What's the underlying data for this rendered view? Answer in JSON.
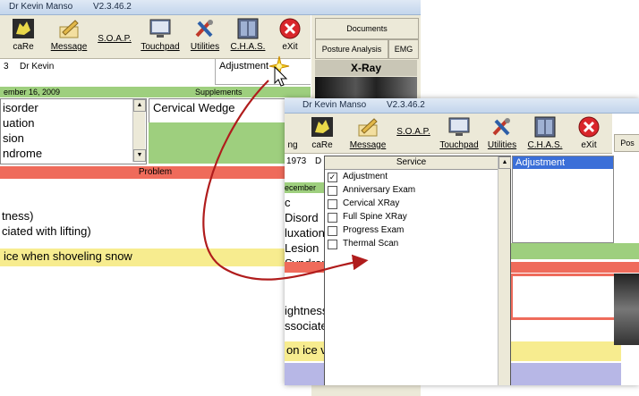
{
  "back": {
    "title": "Dr Kevin Manso",
    "version": "V2.3.46.2",
    "toolbar": [
      "caRe",
      "Message",
      "S.O.A.P.",
      "Touchpad",
      "Utilities",
      "C.H.A.S.",
      "eXit"
    ],
    "patient_num": "3",
    "patient_doc": "Dr Kevin",
    "adjustment_label": "Adjustment",
    "date_bar": "ember 16, 2009",
    "supplements_label": "Supplements",
    "diagnoses": [
      "isorder",
      "uation",
      "sion",
      "ndrome"
    ],
    "supplement_item": "Cervical Wedge",
    "problem_label": "Problem",
    "notes": [
      "tness)",
      "ciated with lifting)"
    ],
    "note_yellow": "ice when shoveling snow",
    "right_tabs": {
      "documents": "Documents",
      "posture": "Posture Analysis",
      "emg": "EMG",
      "xray": "X-Ray"
    }
  },
  "front": {
    "title": "Dr Kevin Manso",
    "version": "V2.3.46.2",
    "toolbar_partial": "ng",
    "toolbar": [
      "caRe",
      "Message",
      "S.O.A.P.",
      "Touchpad",
      "Utilities",
      "C.H.A.S.",
      "eXit"
    ],
    "right_tab_partial": "Pos",
    "patient_num": "1973",
    "patient_doc": "D",
    "date_bar": "ecember",
    "diagnoses": [
      "c Disord",
      "luxation",
      "Lesion",
      "Syndrom"
    ],
    "notes": [
      "ightness",
      "ssociate"
    ],
    "note_yellow": "on ice v",
    "service_header": "Service",
    "services": [
      {
        "label": "Adjustment",
        "checked": true
      },
      {
        "label": "Anniversary Exam",
        "checked": false
      },
      {
        "label": "Cervical XRay",
        "checked": false
      },
      {
        "label": "Full Spine XRay",
        "checked": false
      },
      {
        "label": "Progress Exam",
        "checked": false
      },
      {
        "label": "Thermal Scan",
        "checked": false
      }
    ],
    "selected_service": "Adjustment"
  },
  "colors": {
    "green": "#9ecf7e",
    "red": "#ef6b5b",
    "yellow": "#f7ec8f",
    "lavender": "#b7b7e6",
    "arrow": "#b01c1c",
    "selection": "#3b6fd8"
  }
}
